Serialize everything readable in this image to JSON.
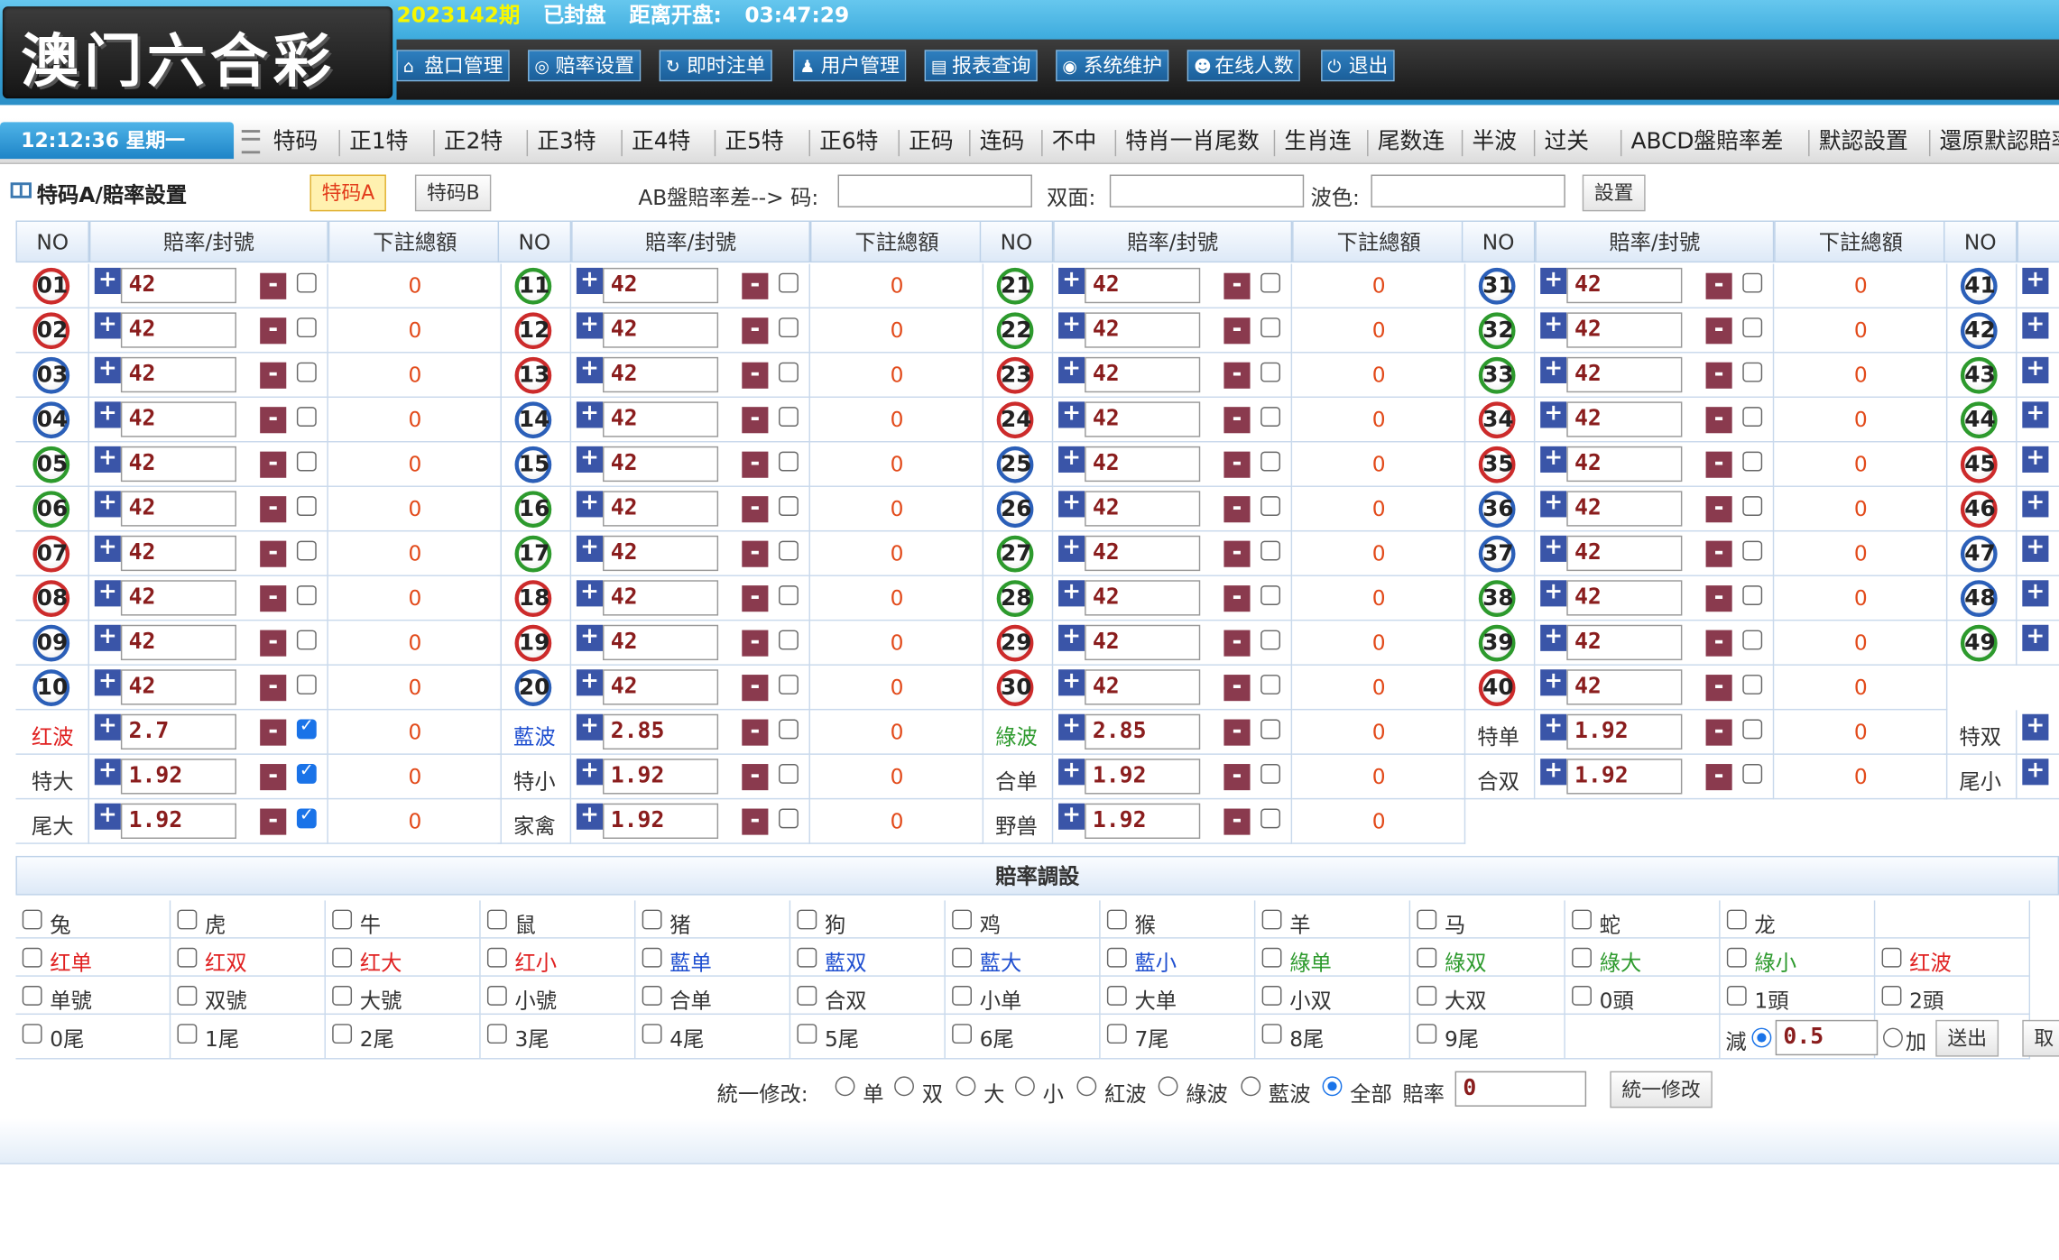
{
  "header": {
    "logo": "澳门六合彩",
    "period": "2023142期",
    "closed_status": "已封盘",
    "countdown_label": "距离开盘:",
    "countdown": "03:47:29",
    "menu": [
      {
        "label": "盘口管理",
        "icon": "home-icon",
        "glyph": "⌂"
      },
      {
        "label": "赔率设置",
        "icon": "target-icon",
        "glyph": "◎"
      },
      {
        "label": "即时注单",
        "icon": "refresh-icon",
        "glyph": "↻"
      },
      {
        "label": "用户管理",
        "icon": "users-icon",
        "glyph": "♟"
      },
      {
        "label": "报表查询",
        "icon": "report-icon",
        "glyph": "▤"
      },
      {
        "label": "系统维护",
        "icon": "broadcast-icon",
        "glyph": "◉"
      },
      {
        "label": "在线人数",
        "icon": "smile-icon",
        "glyph": "☻"
      },
      {
        "label": "退出",
        "icon": "power-icon",
        "glyph": "⏻"
      }
    ]
  },
  "tabbar": {
    "clock": "12:12:36 星期一",
    "tabs": [
      "特码",
      "正1特",
      "正2特",
      "正3特",
      "正4特",
      "正5特",
      "正6特",
      "正码",
      "连码",
      "不中",
      "特肖一肖尾数",
      "生肖连",
      "尾数连",
      "半波",
      "过关",
      "ABCD盤賠率差",
      "默認設置",
      "還原默認賠率"
    ]
  },
  "toolbar": {
    "title": "特码A/賠率設置",
    "btn_a": "特码A",
    "btn_b": "特码B",
    "ab_label": "AB盤賠率差--> 码:",
    "ab_value": "",
    "double_label": "双面:",
    "double_value": "",
    "wave_label": "波色:",
    "wave_value": "",
    "set_btn": "設置"
  },
  "grid": {
    "headers": {
      "no": "NO",
      "odds": "賠率/封號",
      "total": "下註總額"
    },
    "numbers": [
      {
        "no": "01",
        "color": "red",
        "odds": "42",
        "total": "0",
        "checked": false
      },
      {
        "no": "02",
        "color": "red",
        "odds": "42",
        "total": "0",
        "checked": false
      },
      {
        "no": "03",
        "color": "blue",
        "odds": "42",
        "total": "0",
        "checked": false
      },
      {
        "no": "04",
        "color": "blue",
        "odds": "42",
        "total": "0",
        "checked": false
      },
      {
        "no": "05",
        "color": "green",
        "odds": "42",
        "total": "0",
        "checked": false
      },
      {
        "no": "06",
        "color": "green",
        "odds": "42",
        "total": "0",
        "checked": false
      },
      {
        "no": "07",
        "color": "red",
        "odds": "42",
        "total": "0",
        "checked": false
      },
      {
        "no": "08",
        "color": "red",
        "odds": "42",
        "total": "0",
        "checked": false
      },
      {
        "no": "09",
        "color": "blue",
        "odds": "42",
        "total": "0",
        "checked": false
      },
      {
        "no": "10",
        "color": "blue",
        "odds": "42",
        "total": "0",
        "checked": false
      },
      {
        "no": "11",
        "color": "green",
        "odds": "42",
        "total": "0",
        "checked": false
      },
      {
        "no": "12",
        "color": "red",
        "odds": "42",
        "total": "0",
        "checked": false
      },
      {
        "no": "13",
        "color": "red",
        "odds": "42",
        "total": "0",
        "checked": false
      },
      {
        "no": "14",
        "color": "blue",
        "odds": "42",
        "total": "0",
        "checked": false
      },
      {
        "no": "15",
        "color": "blue",
        "odds": "42",
        "total": "0",
        "checked": false
      },
      {
        "no": "16",
        "color": "green",
        "odds": "42",
        "total": "0",
        "checked": false
      },
      {
        "no": "17",
        "color": "green",
        "odds": "42",
        "total": "0",
        "checked": false
      },
      {
        "no": "18",
        "color": "red",
        "odds": "42",
        "total": "0",
        "checked": false
      },
      {
        "no": "19",
        "color": "red",
        "odds": "42",
        "total": "0",
        "checked": false
      },
      {
        "no": "20",
        "color": "blue",
        "odds": "42",
        "total": "0",
        "checked": false
      },
      {
        "no": "21",
        "color": "green",
        "odds": "42",
        "total": "0",
        "checked": false
      },
      {
        "no": "22",
        "color": "green",
        "odds": "42",
        "total": "0",
        "checked": false
      },
      {
        "no": "23",
        "color": "red",
        "odds": "42",
        "total": "0",
        "checked": false
      },
      {
        "no": "24",
        "color": "red",
        "odds": "42",
        "total": "0",
        "checked": false
      },
      {
        "no": "25",
        "color": "blue",
        "odds": "42",
        "total": "0",
        "checked": false
      },
      {
        "no": "26",
        "color": "blue",
        "odds": "42",
        "total": "0",
        "checked": false
      },
      {
        "no": "27",
        "color": "green",
        "odds": "42",
        "total": "0",
        "checked": false
      },
      {
        "no": "28",
        "color": "green",
        "odds": "42",
        "total": "0",
        "checked": false
      },
      {
        "no": "29",
        "color": "red",
        "odds": "42",
        "total": "0",
        "checked": false
      },
      {
        "no": "30",
        "color": "red",
        "odds": "42",
        "total": "0",
        "checked": false
      },
      {
        "no": "31",
        "color": "blue",
        "odds": "42",
        "total": "0",
        "checked": false
      },
      {
        "no": "32",
        "color": "green",
        "odds": "42",
        "total": "0",
        "checked": false
      },
      {
        "no": "33",
        "color": "green",
        "odds": "42",
        "total": "0",
        "checked": false
      },
      {
        "no": "34",
        "color": "red",
        "odds": "42",
        "total": "0",
        "checked": false
      },
      {
        "no": "35",
        "color": "red",
        "odds": "42",
        "total": "0",
        "checked": false
      },
      {
        "no": "36",
        "color": "blue",
        "odds": "42",
        "total": "0",
        "checked": false
      },
      {
        "no": "37",
        "color": "blue",
        "odds": "42",
        "total": "0",
        "checked": false
      },
      {
        "no": "38",
        "color": "green",
        "odds": "42",
        "total": "0",
        "checked": false
      },
      {
        "no": "39",
        "color": "green",
        "odds": "42",
        "total": "0",
        "checked": false
      },
      {
        "no": "40",
        "color": "red",
        "odds": "42",
        "total": "0",
        "checked": false
      },
      {
        "no": "41",
        "color": "blue"
      },
      {
        "no": "42",
        "color": "blue"
      },
      {
        "no": "43",
        "color": "green"
      },
      {
        "no": "44",
        "color": "green"
      },
      {
        "no": "45",
        "color": "red"
      },
      {
        "no": "46",
        "color": "red"
      },
      {
        "no": "47",
        "color": "blue"
      },
      {
        "no": "48",
        "color": "blue"
      },
      {
        "no": "49",
        "color": "green"
      }
    ],
    "specials": [
      [
        {
          "label": "红波",
          "color": "#e02020",
          "odds": "2.7",
          "total": "0",
          "checked": true
        },
        {
          "label": "特大",
          "color": "#333",
          "odds": "1.92",
          "total": "0",
          "checked": true
        },
        {
          "label": "尾大",
          "color": "#333",
          "odds": "1.92",
          "total": "0",
          "checked": true
        }
      ],
      [
        {
          "label": "藍波",
          "color": "#1f4fd0",
          "odds": "2.85",
          "total": "0",
          "checked": false
        },
        {
          "label": "特小",
          "color": "#333",
          "odds": "1.92",
          "total": "0",
          "checked": false
        },
        {
          "label": "家禽",
          "color": "#333",
          "odds": "1.92",
          "total": "0",
          "checked": false
        }
      ],
      [
        {
          "label": "綠波",
          "color": "#2d9a2d",
          "odds": "2.85",
          "total": "0",
          "checked": false
        },
        {
          "label": "合单",
          "color": "#333",
          "odds": "1.92",
          "total": "0",
          "checked": false
        },
        {
          "label": "野兽",
          "color": "#333",
          "odds": "1.92",
          "total": "0",
          "checked": false
        }
      ],
      [
        {
          "label": "特单",
          "color": "#333",
          "odds": "1.92",
          "total": "0",
          "checked": false
        },
        {
          "label": "合双",
          "color": "#333",
          "odds": "1.92",
          "total": "0",
          "checked": false
        }
      ],
      [
        {
          "label": "特双",
          "color": "#333"
        },
        {
          "label": "尾小",
          "color": "#333"
        }
      ]
    ]
  },
  "adjust": {
    "title": "賠率調設",
    "rows": [
      [
        {
          "t": "兔",
          "c": "#333"
        },
        {
          "t": "虎",
          "c": "#333"
        },
        {
          "t": "牛",
          "c": "#333"
        },
        {
          "t": "鼠",
          "c": "#333"
        },
        {
          "t": "猪",
          "c": "#333"
        },
        {
          "t": "狗",
          "c": "#333"
        },
        {
          "t": "鸡",
          "c": "#333"
        },
        {
          "t": "猴",
          "c": "#333"
        },
        {
          "t": "羊",
          "c": "#333"
        },
        {
          "t": "马",
          "c": "#333"
        },
        {
          "t": "蛇",
          "c": "#333"
        },
        {
          "t": "龙",
          "c": "#333"
        }
      ],
      [
        {
          "t": "红单",
          "c": "#e02020"
        },
        {
          "t": "红双",
          "c": "#e02020"
        },
        {
          "t": "红大",
          "c": "#e02020"
        },
        {
          "t": "红小",
          "c": "#e02020"
        },
        {
          "t": "藍单",
          "c": "#1f4fd0"
        },
        {
          "t": "藍双",
          "c": "#1f4fd0"
        },
        {
          "t": "藍大",
          "c": "#1f4fd0"
        },
        {
          "t": "藍小",
          "c": "#1f4fd0"
        },
        {
          "t": "綠单",
          "c": "#2d9a2d"
        },
        {
          "t": "綠双",
          "c": "#2d9a2d"
        },
        {
          "t": "綠大",
          "c": "#2d9a2d"
        },
        {
          "t": "綠小",
          "c": "#2d9a2d"
        },
        {
          "t": "红波",
          "c": "#e02020"
        }
      ],
      [
        {
          "t": "单號",
          "c": "#333"
        },
        {
          "t": "双號",
          "c": "#333"
        },
        {
          "t": "大號",
          "c": "#333"
        },
        {
          "t": "小號",
          "c": "#333"
        },
        {
          "t": "合单",
          "c": "#333"
        },
        {
          "t": "合双",
          "c": "#333"
        },
        {
          "t": "小单",
          "c": "#333"
        },
        {
          "t": "大单",
          "c": "#333"
        },
        {
          "t": "小双",
          "c": "#333"
        },
        {
          "t": "大双",
          "c": "#333"
        },
        {
          "t": "0頭",
          "c": "#333"
        },
        {
          "t": "1頭",
          "c": "#333"
        },
        {
          "t": "2頭",
          "c": "#333"
        }
      ],
      [
        {
          "t": "0尾",
          "c": "#333"
        },
        {
          "t": "1尾",
          "c": "#333"
        },
        {
          "t": "2尾",
          "c": "#333"
        },
        {
          "t": "3尾",
          "c": "#333"
        },
        {
          "t": "4尾",
          "c": "#333"
        },
        {
          "t": "5尾",
          "c": "#333"
        },
        {
          "t": "6尾",
          "c": "#333"
        },
        {
          "t": "7尾",
          "c": "#333"
        },
        {
          "t": "8尾",
          "c": "#333"
        },
        {
          "t": "9尾",
          "c": "#333"
        }
      ]
    ],
    "minus_label": "減",
    "step_value": "0.5",
    "plus_label": "加",
    "send_btn": "送出",
    "cancel_btn": "取"
  },
  "uniform": {
    "label": "統一修改:",
    "options": [
      "单",
      "双",
      "大",
      "小",
      "紅波",
      "綠波",
      "藍波",
      "全部"
    ],
    "selected": "全部",
    "odds_label": "賠率",
    "odds_value": "0",
    "btn": "統一修改"
  }
}
